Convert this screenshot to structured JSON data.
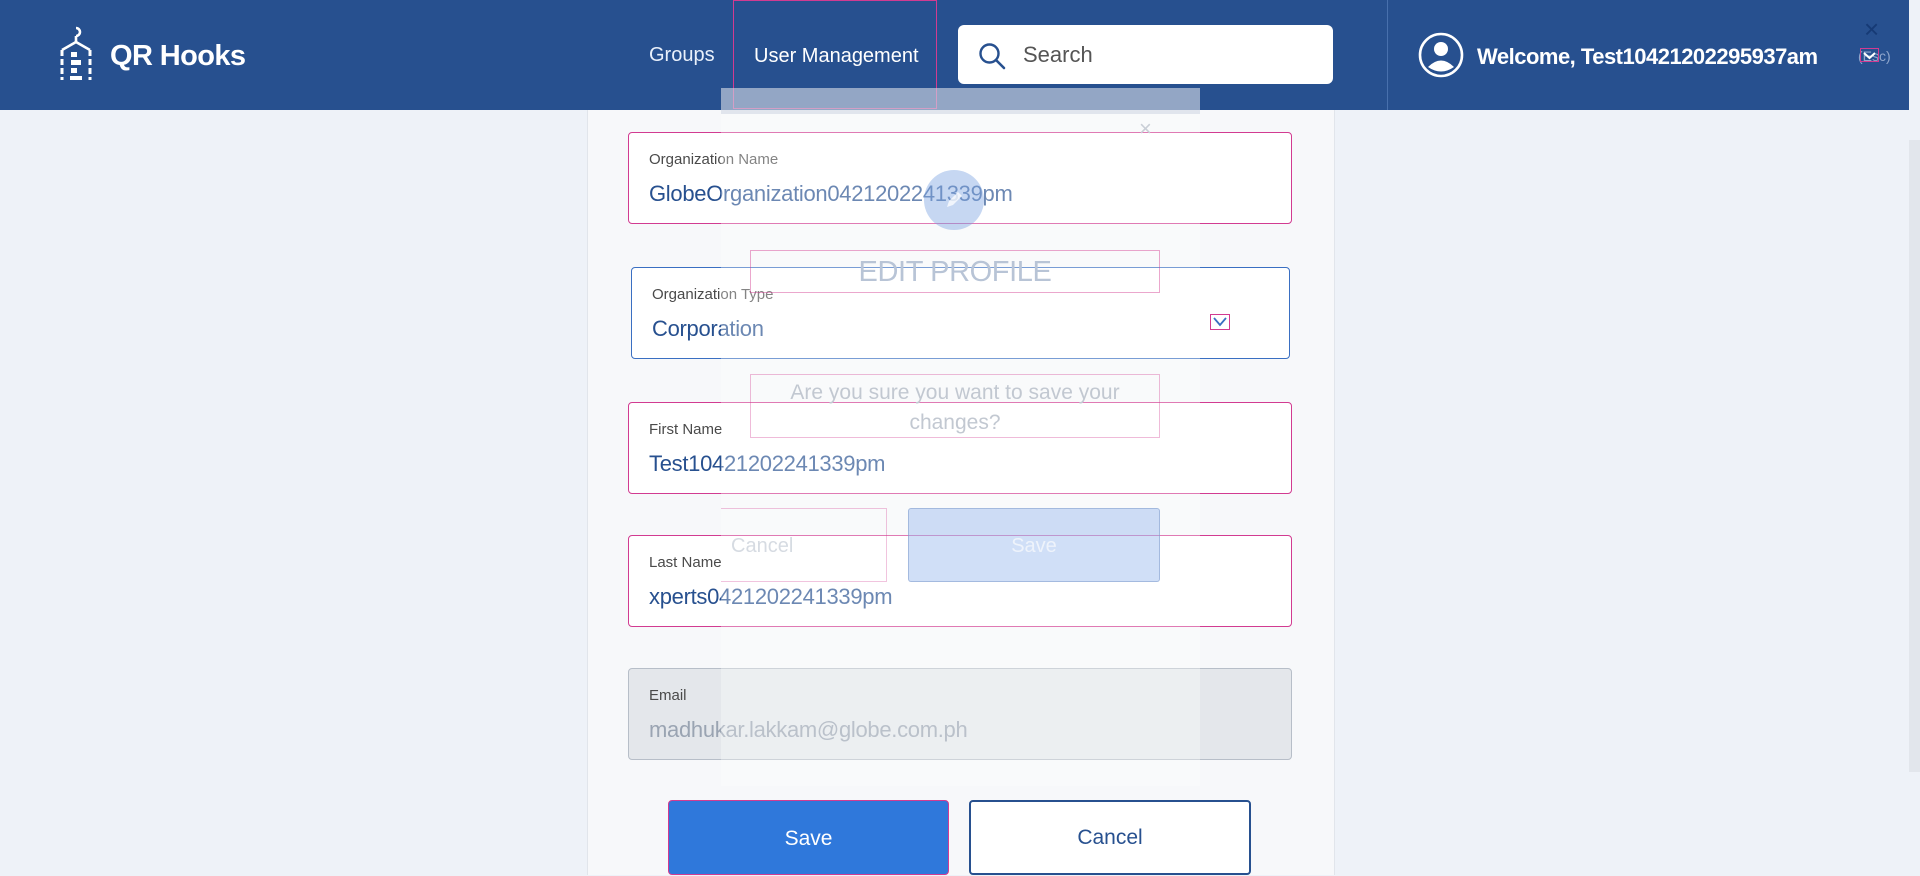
{
  "header": {
    "brand": "QR Hooks",
    "nav": {
      "groups": "Groups",
      "user_management": "User Management"
    },
    "search_placeholder": "Search",
    "welcome": "Welcome, Test10421202295937am",
    "esc_hint": "(Esc)"
  },
  "form": {
    "organization_name": {
      "label": "Organization Name",
      "value": "GlobeOrganization0421202241339pm"
    },
    "organization_type": {
      "label": "Organization Type",
      "value": "Corporation"
    },
    "first_name": {
      "label": "First Name",
      "value": "Test10421202241339pm"
    },
    "last_name": {
      "label": "Last Name",
      "value": "xperts0421202241339pm"
    },
    "email": {
      "label": "Email",
      "value": "madhukar.lakkam@globe.com.ph"
    },
    "save_label": "Save",
    "cancel_label": "Cancel"
  },
  "dialog": {
    "title": "EDIT PROFILE",
    "message": "Are you sure you want to save your changes?",
    "cancel_label": "Cancel",
    "save_label": "Save"
  },
  "colors": {
    "header_bg": "#27508f",
    "primary_button": "#2f78db",
    "highlight_outline": "#d23b91",
    "page_bg": "#eef2f8"
  }
}
